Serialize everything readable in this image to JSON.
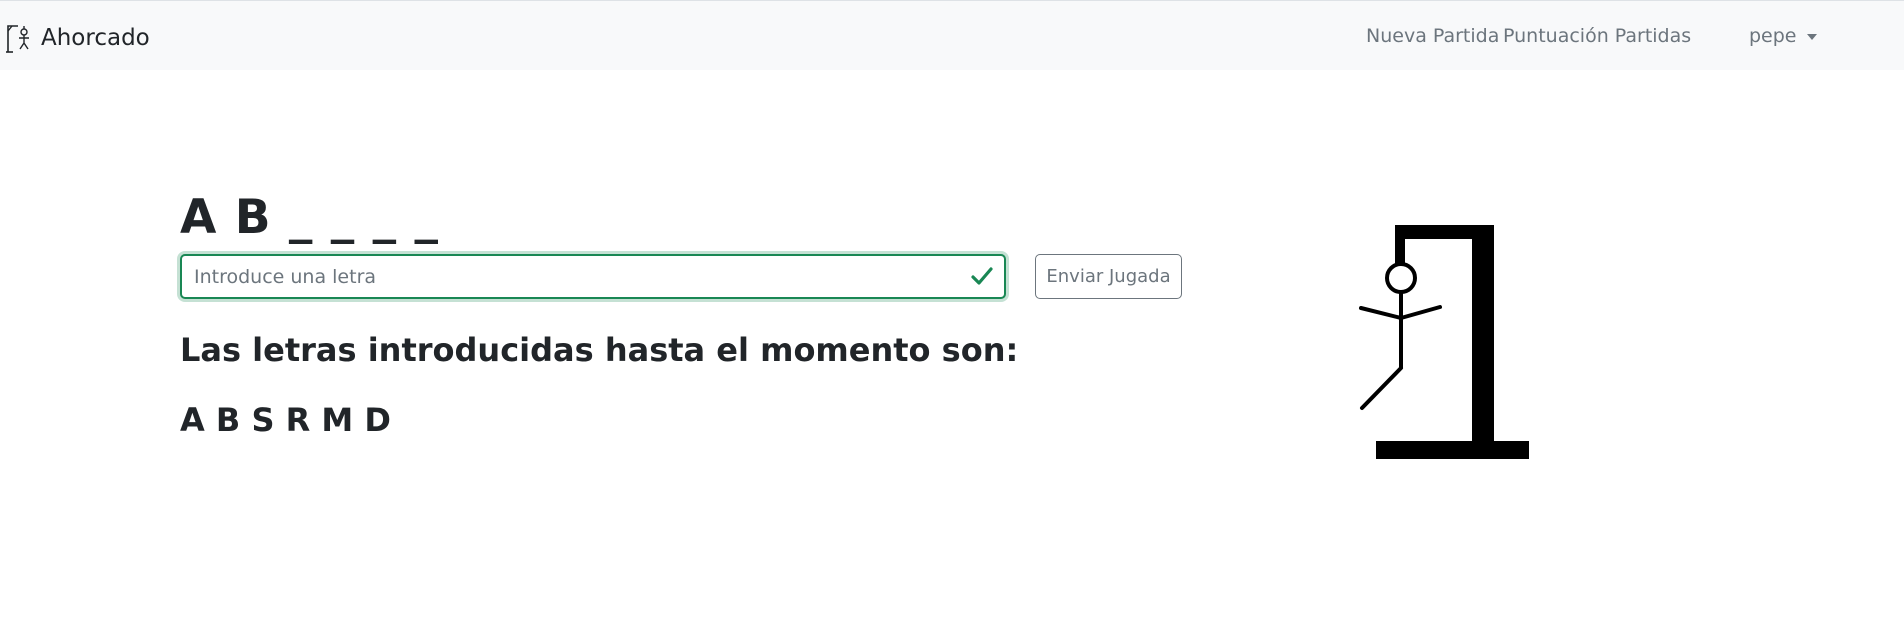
{
  "navbar": {
    "brand": "Ahorcado",
    "links": [
      "Nueva Partida",
      "Puntuación Partidas"
    ],
    "user": "pepe"
  },
  "game": {
    "word_display": "A B _ _ _ _",
    "input": {
      "placeholder": "Introduce una letra",
      "value": ""
    },
    "submit_label": "Enviar Jugada",
    "used_letters_heading": "Las letras introducidas hasta el momento son:",
    "used_letters": "A B S R M D"
  },
  "colors": {
    "navbar_bg": "#f8f9fa",
    "valid_green": "#198754",
    "muted": "#6c757d",
    "text": "#212529"
  }
}
